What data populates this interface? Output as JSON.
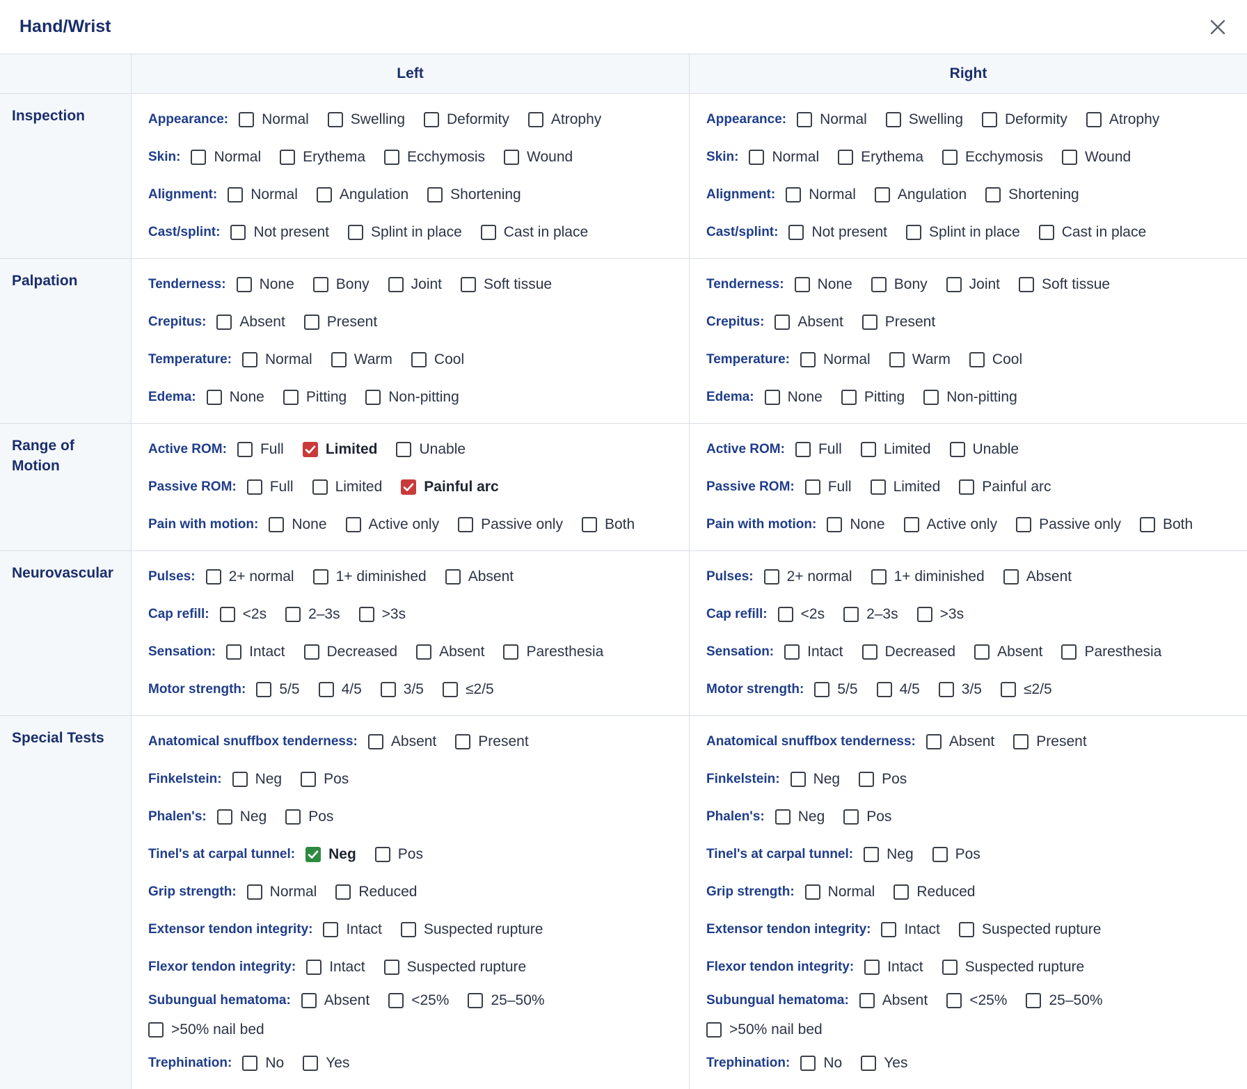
{
  "window": {
    "title": "Hand/Wrist",
    "close_icon": "close-icon"
  },
  "columns": {
    "left": "Left",
    "right": "Right"
  },
  "sections": [
    {
      "title": "Inspection",
      "rows": [
        {
          "label": "Appearance:",
          "options": [
            "Normal",
            "Swelling",
            "Deformity",
            "Atrophy"
          ]
        },
        {
          "label": "Skin:",
          "options": [
            "Normal",
            "Erythema",
            "Ecchymosis",
            "Wound"
          ]
        },
        {
          "label": "Alignment:",
          "options": [
            "Normal",
            "Angulation",
            "Shortening"
          ]
        },
        {
          "label": "Cast/splint:",
          "options": [
            "Not present",
            "Splint in place",
            "Cast in place"
          ]
        }
      ]
    },
    {
      "title": "Palpation",
      "rows": [
        {
          "label": "Tenderness:",
          "options": [
            "None",
            "Bony",
            "Joint",
            "Soft tissue"
          ]
        },
        {
          "label": "Crepitus:",
          "options": [
            "Absent",
            "Present"
          ]
        },
        {
          "label": "Temperature:",
          "options": [
            "Normal",
            "Warm",
            "Cool"
          ]
        },
        {
          "label": "Edema:",
          "options": [
            "None",
            "Pitting",
            "Non-pitting"
          ]
        }
      ]
    },
    {
      "title": "Range of Motion",
      "rows": [
        {
          "label": "Active ROM:",
          "options": [
            "Full",
            "Limited",
            "Unable"
          ]
        },
        {
          "label": "Passive ROM:",
          "options": [
            "Full",
            "Limited",
            "Painful arc"
          ]
        },
        {
          "label": "Pain with motion:",
          "options": [
            "None",
            "Active only",
            "Passive only",
            "Both"
          ]
        }
      ]
    },
    {
      "title": "Neurovascular",
      "rows": [
        {
          "label": "Pulses:",
          "options": [
            "2+ normal",
            "1+ diminished",
            "Absent"
          ]
        },
        {
          "label": "Cap refill:",
          "options": [
            "<2s",
            "2–3s",
            ">3s"
          ]
        },
        {
          "label": "Sensation:",
          "options": [
            "Intact",
            "Decreased",
            "Absent",
            "Paresthesia"
          ]
        },
        {
          "label": "Motor strength:",
          "options": [
            "5/5",
            "4/5",
            "3/5",
            "≤2/5"
          ]
        }
      ]
    },
    {
      "title": "Special Tests",
      "rows": [
        {
          "label": "Anatomical snuffbox tenderness:",
          "options": [
            "Absent",
            "Present"
          ]
        },
        {
          "label": "Finkelstein:",
          "options": [
            "Neg",
            "Pos"
          ]
        },
        {
          "label": "Phalen's:",
          "options": [
            "Neg",
            "Pos"
          ]
        },
        {
          "label": "Tinel's at carpal tunnel:",
          "options": [
            "Neg",
            "Pos"
          ]
        },
        {
          "label": "Grip strength:",
          "options": [
            "Normal",
            "Reduced"
          ]
        },
        {
          "label": "Extensor tendon integrity:",
          "options": [
            "Intact",
            "Suspected rupture"
          ]
        },
        {
          "label": "Flexor tendon integrity:",
          "options": [
            "Intact",
            "Suspected rupture"
          ]
        },
        {
          "label": "Subungual hematoma:",
          "options": [
            "Absent",
            "<25%",
            "25–50%",
            ">50% nail bed"
          ],
          "wrap_before": 3
        },
        {
          "label": "Trephination:",
          "options": [
            "No",
            "Yes"
          ]
        }
      ]
    }
  ],
  "selections": {
    "left": [
      {
        "section": 2,
        "row": 0,
        "option": 1,
        "color": "#c93a3a"
      },
      {
        "section": 2,
        "row": 1,
        "option": 2,
        "color": "#c93a3a"
      },
      {
        "section": 4,
        "row": 3,
        "option": 0,
        "color": "#2e8a41"
      }
    ],
    "right": []
  },
  "colors": {
    "title": "#1a2e6b",
    "row_label": "#1f3d8a",
    "abnormal_check": "#c93a3a",
    "normal_check": "#2e8a41",
    "section_background": "#f5f8fb",
    "border": "#d9dee6"
  }
}
